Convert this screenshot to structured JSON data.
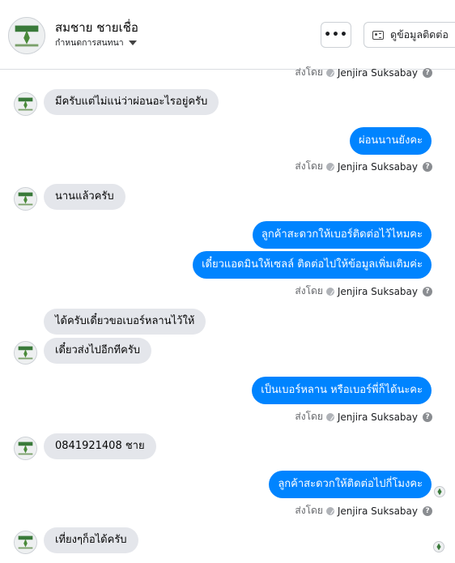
{
  "header": {
    "contact_name": "สมชาย ชายเชื่อ",
    "status": "กำหนดการสนทนา",
    "more_label": "•••",
    "contact_info_label": "ดูข้อมูลติดต่อ"
  },
  "sent_by_prefix": "ส่งโดย",
  "agent_name": "Jenjira Suksabay",
  "help_glyph": "?",
  "messages": {
    "m1": "มีครับแต่ไม่แน่ว่าผ่อนอะไรอยู่ครับ",
    "m2": "ผ่อนนานยังคะ",
    "m3": "นานแล้วครับ",
    "m4": "ลูกค้าสะดวกให้เบอร์ติดต่อไว้ไหมคะ",
    "m5": "เดี๋ยวแอดมินให้เซลล์ ติดต่อไปให้ข้อมูลเพิ่มเติมค่ะ",
    "m6": "ได้ครับเดี๋ยวขอเบอร์หลานไว้ให้",
    "m7": "เดี๋ยวส่งไปอีกทีครับ",
    "m8": "เป็นเบอร์หลาน หรือเบอร์พี่ก็ได้นะคะ",
    "m9": "0841921408 ชาย",
    "m10": "ลูกค้าสะดวกให้ติดต่อไปกี่โมงคะ",
    "m11": "เที่ยงๆก็อได้ครับ"
  },
  "colors": {
    "outgoing_bubble": "#0084ff",
    "incoming_bubble": "#e4e6eb",
    "logo_green": "#3a7a3a"
  }
}
